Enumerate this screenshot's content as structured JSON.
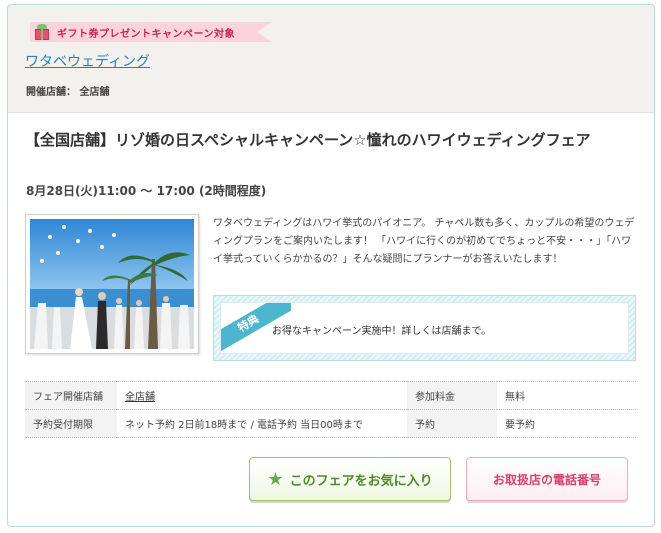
{
  "header": {
    "gift_campaign": "ギフト券プレゼントキャンペーン対象",
    "company_name": "ワタベウェディング",
    "venue_line": "開催店舗： 全店舗"
  },
  "fair": {
    "title": "【全国店舗】リゾ婚の日スペシャルキャンペーン☆憧れのハワイウェディングフェア",
    "datetime": "8月28日(火)11:00 ～ 17:00 (2時間程度)",
    "description": "ワタベウェディングはハワイ挙式のパイオニア。 チャペル数も多く、カップルの希望のウェディングプランをご案内いたします！ 「ハワイに行くのが初めてでちょっと不安・・・」「ハワイ挙式っていくらかかるの？」そんな疑問にプランナーがお答えいたします！"
  },
  "perk": {
    "badge": "特典",
    "text": "お得なキャンペーン実施中！詳しくは店舗まで。"
  },
  "info_table": {
    "rows": [
      {
        "label1": "フェア開催店舗",
        "value1": "全店舗",
        "label2": "参加料金",
        "value2": "無料"
      },
      {
        "label1": "予約受付期限",
        "value1": "ネット予約 2日前18時まで / 電話予約 当日00時まで",
        "label2": "予約",
        "value2": "要予約"
      }
    ]
  },
  "buttons": {
    "favorite": "このフェアをお気に入り",
    "favorite_icon": "star-icon",
    "phone": "お取扱店の電話番号"
  },
  "colors": {
    "link": "#2a7fb8",
    "favorite_green": "#4f8a2b",
    "phone_pink": "#d5426b",
    "perk_teal": "#4db6cf",
    "gift_pink": "#fbd3dc"
  }
}
